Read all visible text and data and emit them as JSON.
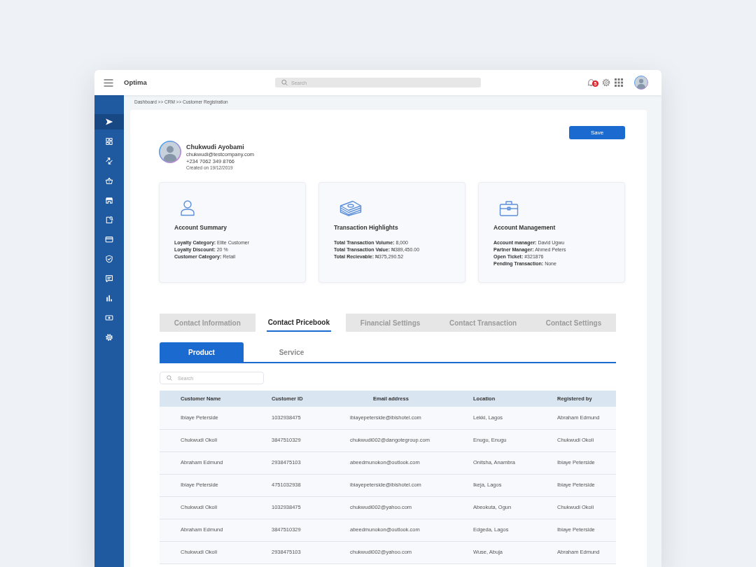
{
  "app": {
    "title": "Optima"
  },
  "topbar": {
    "search": {
      "placeholder": "Search"
    },
    "notification_badge": "5"
  },
  "sidebar": {
    "items": [
      {
        "selected": true
      },
      {
        "selected": false
      },
      {
        "selected": false
      },
      {
        "selected": false
      },
      {
        "selected": false
      },
      {
        "selected": false
      },
      {
        "selected": false
      },
      {
        "selected": false
      },
      {
        "selected": false
      },
      {
        "selected": false
      },
      {
        "selected": false
      },
      {
        "selected": false
      }
    ]
  },
  "breadcrumb": "Dashboard >> CRM >> Customer Registration",
  "save_button": "Save",
  "profile": {
    "name": "Chukwudi Ayobami",
    "email": "chukwudi@testcompany.com",
    "phone": "+234 7062 349 8766",
    "created": "Created on 19/12/2019"
  },
  "summary_cards": [
    {
      "title": "Account Summary",
      "fields": [
        {
          "label": "Loyalty Category:",
          "value": "Elite Customer"
        },
        {
          "label": "Loyalty Discount:",
          "value": "20 %"
        },
        {
          "label": "Customer Category:",
          "value": "Retail"
        }
      ]
    },
    {
      "title": "Transaction Highlights",
      "fields": [
        {
          "label": "Total Transaction Volume:",
          "value": "8,000"
        },
        {
          "label": "Total Transaction Value:",
          "value": "₦389,450.00"
        },
        {
          "label": "Total Recievable:",
          "value": "₦375,290.52"
        }
      ]
    },
    {
      "title": "Account Management",
      "fields": [
        {
          "label": "Account manager:",
          "value": "David Ugwu"
        },
        {
          "label": "Partner Manager:",
          "value": "Ahmed Peters"
        },
        {
          "label": "Open Ticket:",
          "value": "#321876"
        },
        {
          "label": "Pending Transaction:",
          "value": "None"
        }
      ]
    }
  ],
  "tabs": [
    {
      "label": "Contact Information",
      "selected": false
    },
    {
      "label": "Contact Pricebook",
      "selected": true
    },
    {
      "label": "Financial Settings",
      "selected": false
    },
    {
      "label": "Contact Transaction",
      "selected": false
    },
    {
      "label": "Contact Settings",
      "selected": false
    }
  ],
  "subtabs": [
    {
      "label": "Product",
      "selected": true
    },
    {
      "label": "Service",
      "selected": false
    }
  ],
  "table": {
    "search": {
      "placeholder": "Search"
    },
    "columns": [
      "Customer Name",
      "Customer ID",
      "Email address",
      "Location",
      "Registered by"
    ],
    "rows": [
      [
        "Ibiaye Peterside",
        "1032938475",
        "ibiayepeterside@ibishotel.com",
        "Lekki, Lagos",
        "Abraham Edmund"
      ],
      [
        "Chukwudi Okoli",
        "3847510329",
        "chukwudi002@dangotegroup.com",
        "Enugu, Enugu",
        "Chukwudi Okoli"
      ],
      [
        "Abraham Edmund",
        "2938475103",
        "abeedmunokon@outlook.com",
        "Onitsha, Anambra",
        "Ibiaye Peterside"
      ],
      [
        "Ibiaye Peterside",
        "4751032938",
        "ibiayepeterside@ibishotel.com",
        "Ikeja, Lagos",
        "Ibiaye Peterside"
      ],
      [
        "Chukwudi Okoli",
        "1032938475",
        "chukwudi002@yahoo.com",
        "Abeokuta, Ogun",
        "Chukwudi Okoli"
      ],
      [
        "Abraham Edmund",
        "3847510329",
        "abeedmunokon@outlook.com",
        "Edgeda, Lagos",
        "Ibiaye Peterside"
      ],
      [
        "Chukwudi Okoli",
        "2938475103",
        "chukwudi002@yahoo.com",
        "Wuse, Abuja",
        "Abraham Edmund"
      ]
    ]
  }
}
